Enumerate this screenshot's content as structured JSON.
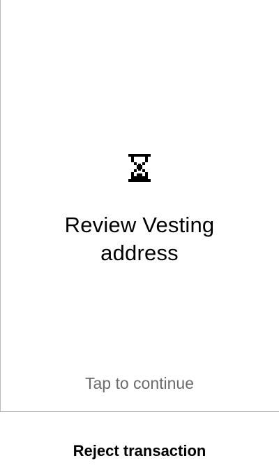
{
  "status_icon": "hourglass-icon",
  "review": {
    "title_line1": "Review Vesting",
    "title_line2": "address"
  },
  "hint": {
    "tap_label": "Tap to continue"
  },
  "footer": {
    "reject_label": "Reject transaction"
  },
  "colors": {
    "background": "#ffffff",
    "text": "#000000",
    "muted_text": "#6b6b6b",
    "divider": "#b8b8b8"
  }
}
